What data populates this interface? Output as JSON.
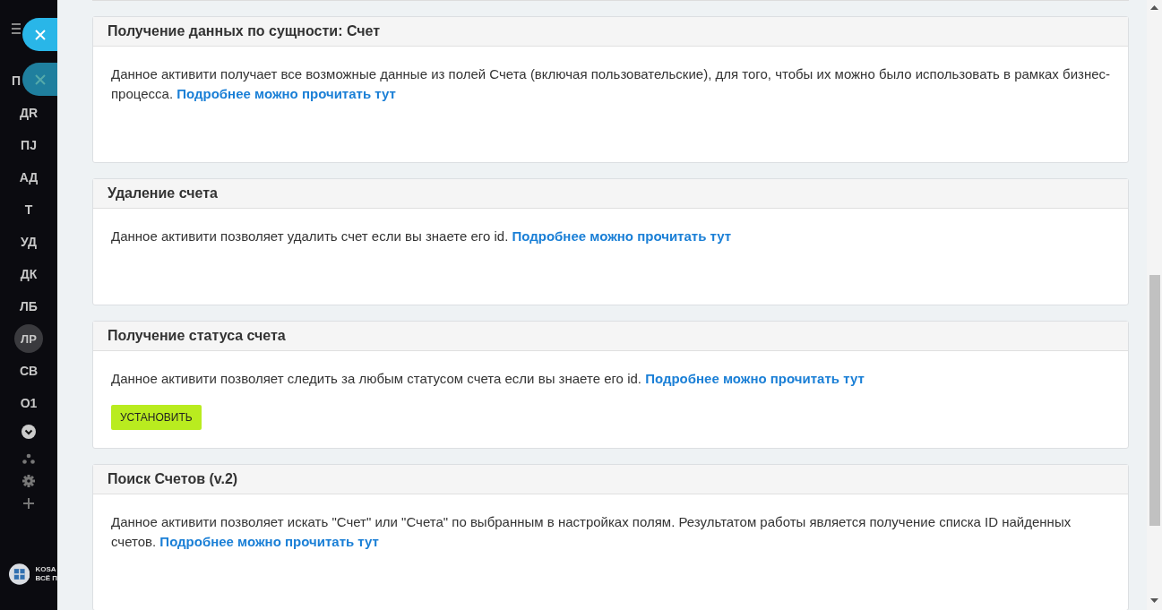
{
  "sidebar": {
    "items": [
      {
        "label": "П",
        "selected": false
      },
      {
        "label": "ДR",
        "selected": false
      },
      {
        "label": "ПЈ",
        "selected": false
      },
      {
        "label": "АД",
        "selected": false
      },
      {
        "label": "Т",
        "selected": false
      },
      {
        "label": "УД",
        "selected": false
      },
      {
        "label": "ДК",
        "selected": false
      },
      {
        "label": "ЛБ",
        "selected": false
      },
      {
        "label": "ЛР",
        "selected": true
      },
      {
        "label": "СВ",
        "selected": false
      },
      {
        "label": "О1",
        "selected": false
      }
    ],
    "logo_lines": [
      "KOSA",
      "ВСЁ П"
    ]
  },
  "cards": [
    {
      "title": "Получение данных по сущности: Счет",
      "text": "Данное активити получает все возможные данные из полей Счета (включая пользовательские), для того, чтобы их можно было использовать в рамках бизнес-процесса.",
      "link": "Подробнее можно прочитать тут"
    },
    {
      "title": "Удаление счета",
      "text": "Данное активити позволяет удалить счет если вы знаете его id.",
      "link": "Подробнее можно прочитать тут"
    },
    {
      "title": "Получение статуса счета",
      "text": "Данное активити позволяет следить за любым статусом счета если вы знаете его id.",
      "link": "Подробнее можно прочитать тут",
      "button": "УСТАНОВИТЬ"
    },
    {
      "title": "Поиск Счетов (v.2)",
      "text": "Данное активити позволяет искать \"Счет\" или \"Счета\" по выбранным в настройках полям. Результатом работы является получение списка ID найденных счетов.",
      "link": "Подробнее можно прочитать тут"
    }
  ]
}
